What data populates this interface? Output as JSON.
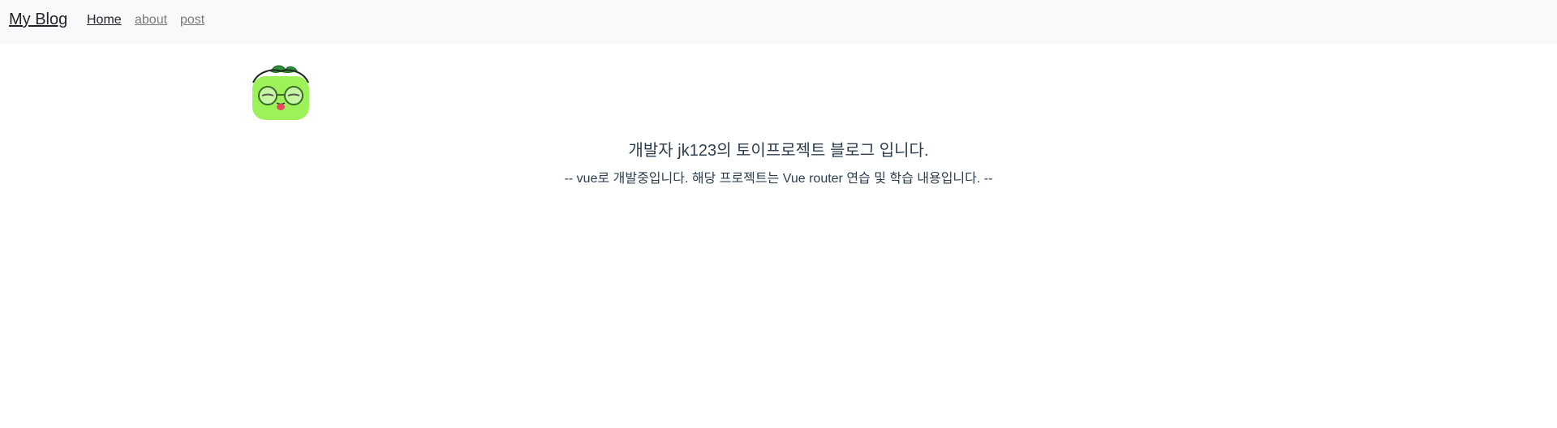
{
  "navbar": {
    "brand": "My Blog",
    "links": [
      {
        "label": "Home",
        "active": true
      },
      {
        "label": "about",
        "active": false
      },
      {
        "label": "post",
        "active": false
      }
    ]
  },
  "main": {
    "logo_icon": "green-apple-character-icon",
    "headline": "개발자 jk123의 토이프로젝트 블로그 입니다.",
    "subline": "-- vue로 개발중입니다. 해당 프로젝트는 Vue router 연습 및 학습 내용입니다. --"
  },
  "colors": {
    "navbar_bg": "#f8f9fa",
    "text": "#2c3e50",
    "active_link": "#212529",
    "inactive_link": "#7a7a7a",
    "logo_green": "#9df25a"
  }
}
